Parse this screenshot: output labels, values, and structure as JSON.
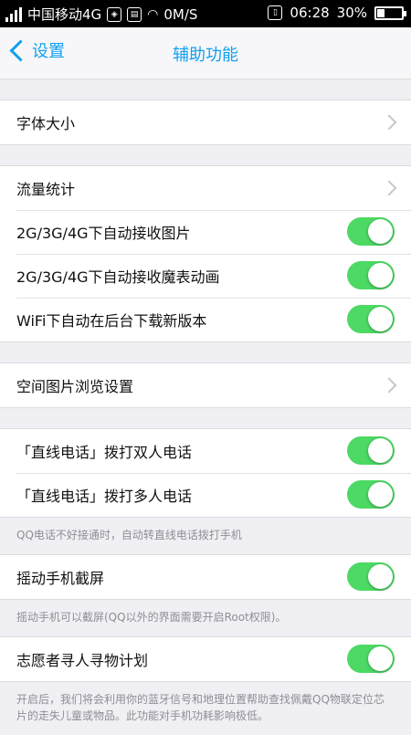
{
  "status_bar": {
    "carrier": "中国移动4G",
    "speed": "0M/S",
    "time": "06:28",
    "battery": "30%",
    "battery_level": 0.3
  },
  "nav": {
    "back_label": "设置",
    "title": "辅助功能"
  },
  "groups": {
    "g1": {
      "font_size": "字体大小"
    },
    "g2": {
      "traffic_stats": "流量统计",
      "auto_receive_images": "2G/3G/4G下自动接收图片",
      "auto_receive_magic_emoji": "2G/3G/4G下自动接收魔表动画",
      "wifi_auto_download": "WiFi下自动在后台下载新版本"
    },
    "g3": {
      "qzone_image_settings": "空间图片浏览设置"
    },
    "g4": {
      "direct_call_double": "「直线电话」拨打双人电话",
      "direct_call_multi": "「直线电话」拨打多人电话",
      "note": "QQ电话不好接通时，自动转直线电话拨打手机"
    },
    "g5": {
      "shake_screenshot": "摇动手机截屏",
      "note": "摇动手机可以截屏(QQ以外的界面需要开启Root权限)。"
    },
    "g6": {
      "volunteer_search": "志愿者寻人寻物计划",
      "note": "开启后，我们将会利用你的蓝牙信号和地理位置帮助查找佩戴QQ物联定位芯片的走失儿童或物品。此功能对手机功耗影响极低。"
    }
  },
  "toggles": {
    "auto_receive_images": true,
    "auto_receive_magic_emoji": true,
    "wifi_auto_download": true,
    "direct_call_double": true,
    "direct_call_multi": true,
    "shake_screenshot": true,
    "volunteer_search": true
  },
  "colors": {
    "accent": "#12a0ef",
    "toggle_on": "#4cd964",
    "background": "#efeff4"
  }
}
